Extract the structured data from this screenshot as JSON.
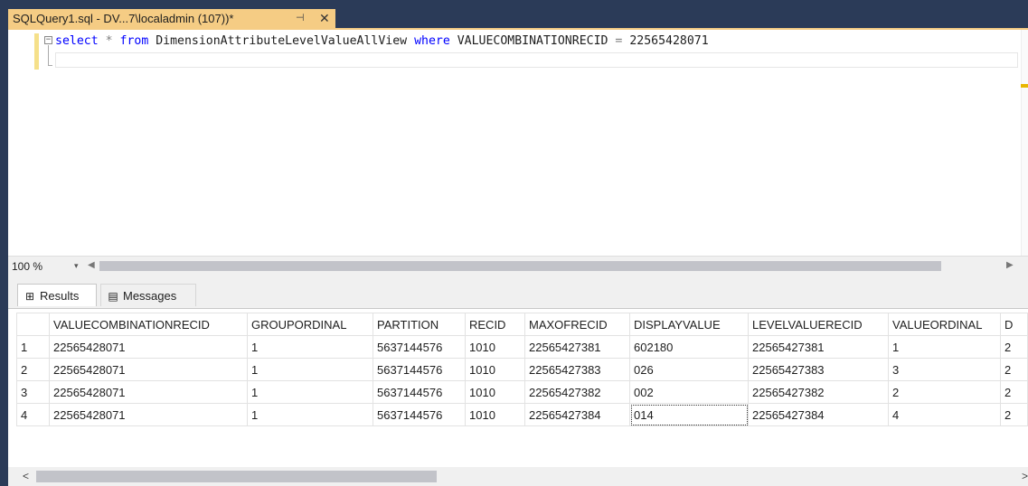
{
  "tab": {
    "title": "SQLQuery1.sql - DV...7\\localadmin (107))*",
    "pin_glyph": "⊣",
    "close_glyph": "✕"
  },
  "editor": {
    "fold_glyph": "−",
    "line1": {
      "kw_select": "select",
      "star": "*",
      "kw_from": "from",
      "table": "DimensionAttributeLevelValueAllView",
      "kw_where": "where",
      "column": "VALUECOMBINATIONRECID",
      "eq": "=",
      "value": "22565428071"
    }
  },
  "zoom": {
    "label": "100 %",
    "arrow": "▾"
  },
  "scroll": {
    "left": "◀",
    "right": "▶",
    "grid_left": "<",
    "grid_right": ">"
  },
  "result_tabs": {
    "results": {
      "label": "Results",
      "icon": "⊞"
    },
    "messages": {
      "label": "Messages",
      "icon": "▤"
    }
  },
  "grid": {
    "columns": [
      "VALUECOMBINATIONRECID",
      "GROUPORDINAL",
      "PARTITION",
      "RECID",
      "MAXOFRECID",
      "DISPLAYVALUE",
      "LEVELVALUERECID",
      "VALUEORDINAL",
      "D"
    ],
    "rows": [
      {
        "n": "1",
        "cells": [
          "22565428071",
          "1",
          "5637144576",
          "1010",
          "22565427381",
          "602180",
          "22565427381",
          "1",
          "2"
        ]
      },
      {
        "n": "2",
        "cells": [
          "22565428071",
          "1",
          "5637144576",
          "1010",
          "22565427383",
          "026",
          "22565427383",
          "3",
          "2"
        ]
      },
      {
        "n": "3",
        "cells": [
          "22565428071",
          "1",
          "5637144576",
          "1010",
          "22565427382",
          "002",
          "22565427382",
          "2",
          "2"
        ]
      },
      {
        "n": "4",
        "cells": [
          "22565428071",
          "1",
          "5637144576",
          "1010",
          "22565427384",
          "014",
          "22565427384",
          "4",
          "2"
        ]
      }
    ]
  },
  "colors": {
    "frame": "#2b3b58",
    "tab_active": "#f5cc84",
    "keyword": "#0000ff"
  }
}
